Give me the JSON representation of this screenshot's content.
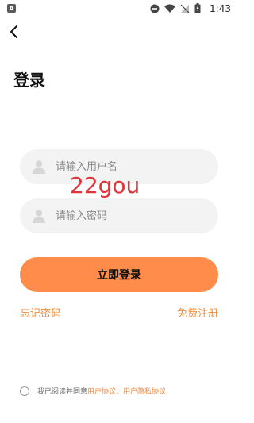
{
  "status_bar": {
    "app_badge": "A",
    "time": "1:43"
  },
  "page": {
    "title": "登录"
  },
  "form": {
    "username_placeholder": "请输入用户名",
    "password_placeholder": "请输入密码",
    "login_label": "立即登录",
    "forgot_label": "忘记密码",
    "register_label": "免费注册"
  },
  "watermark": "22gou",
  "agreement": {
    "prefix": "我已阅读并同意",
    "user_agreement": "用户协议",
    "separator": "、",
    "privacy_agreement": "用户隐私协议"
  },
  "colors": {
    "accent": "#ff8c4a",
    "link": "#f28a3a",
    "field_bg": "#f3f3f3",
    "watermark": "#e0333a"
  }
}
